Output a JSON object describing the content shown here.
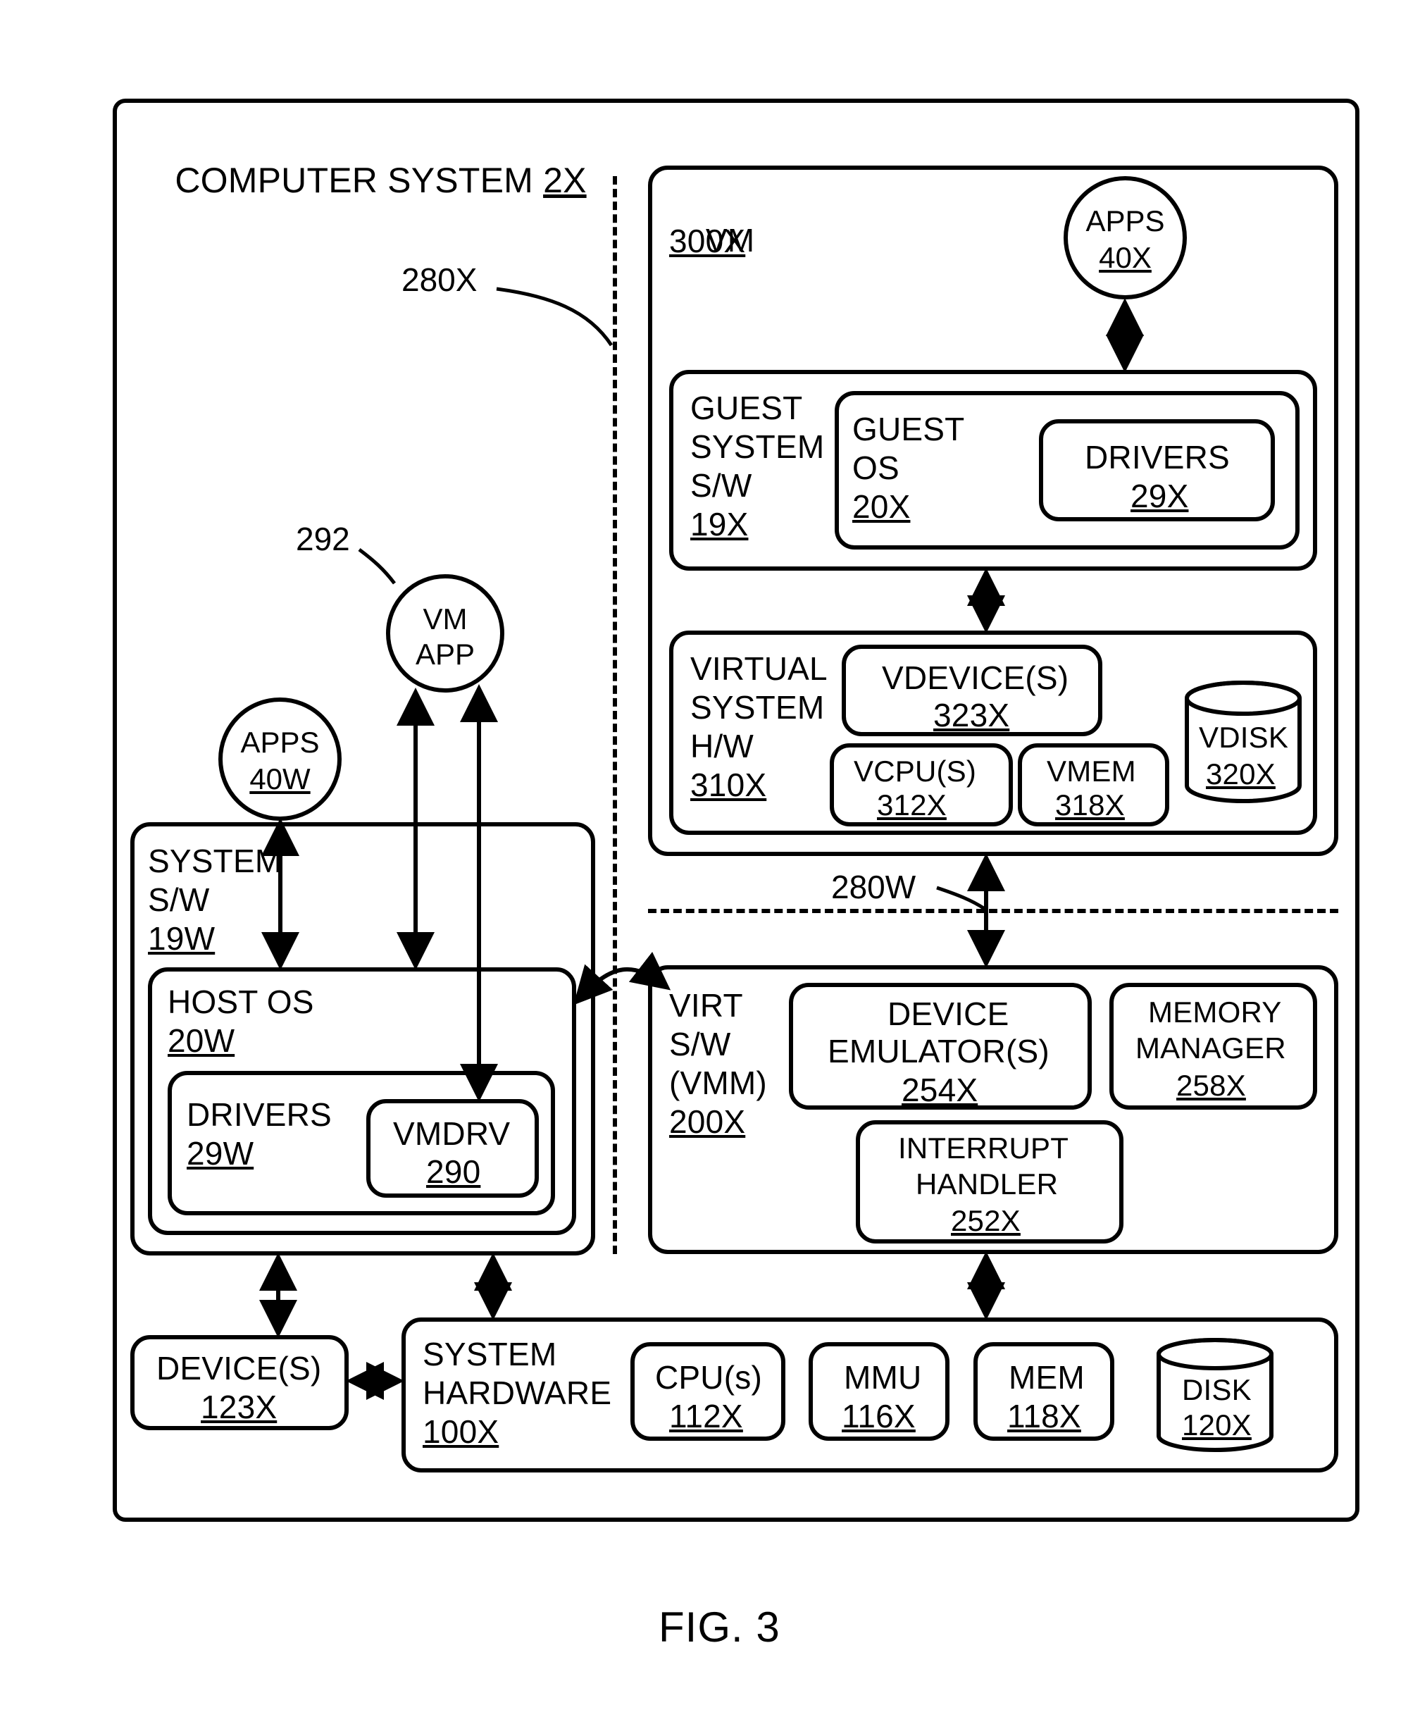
{
  "figure_caption": "FIG. 3",
  "outer": {
    "title": "COMPUTER SYSTEM",
    "ref": "2X"
  },
  "callouts": {
    "c280x": "280X",
    "c292": "292",
    "c280w": "280W"
  },
  "apps40x": {
    "l1": "APPS",
    "ref": "40X"
  },
  "apps40w": {
    "l1": "APPS",
    "ref": "40W"
  },
  "vmapp": {
    "l1": "VM",
    "l2": "APP"
  },
  "vm": {
    "title": "VM",
    "ref": "300X"
  },
  "guest_sw": {
    "l1": "GUEST",
    "l2": "SYSTEM",
    "l3": "S/W",
    "ref": "19X"
  },
  "guest_os": {
    "l1": "GUEST",
    "l2": "OS",
    "ref": "20X"
  },
  "drivers29x": {
    "l1": "DRIVERS",
    "ref": "29X"
  },
  "vhw": {
    "l1": "VIRTUAL",
    "l2": "SYSTEM",
    "l3": "H/W",
    "ref": "310X"
  },
  "vdevices": {
    "l1": "VDEVICE(S)",
    "ref": "323X"
  },
  "vcpus": {
    "l1": "VCPU(S)",
    "ref": "312X"
  },
  "vmem": {
    "l1": "VMEM",
    "ref": "318X"
  },
  "vdisk": {
    "l1": "VDISK",
    "ref": "320X"
  },
  "vmm": {
    "l1": "VIRT",
    "l2": "S/W",
    "l3": "(VMM)",
    "ref": "200X"
  },
  "devemu": {
    "l1": "DEVICE",
    "l2": "EMULATOR(S)",
    "ref": "254X"
  },
  "memmgr": {
    "l1": "MEMORY",
    "l2": "MANAGER",
    "ref": "258X"
  },
  "inth": {
    "l1": "INTERRUPT",
    "l2": "HANDLER",
    "ref": "252X"
  },
  "sys_sw": {
    "l1": "SYSTEM",
    "l2": "S/W",
    "ref": "19W"
  },
  "hostos": {
    "l1": "HOST OS",
    "ref": "20W"
  },
  "drivers29w": {
    "l1": "DRIVERS",
    "ref": "29W"
  },
  "vmdrv": {
    "l1": "VMDRV",
    "ref": "290"
  },
  "devices": {
    "l1": "DEVICE(S)",
    "ref": "123X"
  },
  "syshw": {
    "l1": "SYSTEM",
    "l2": "HARDWARE",
    "ref": "100X"
  },
  "cpus": {
    "l1": "CPU(s)",
    "ref": "112X"
  },
  "mmu": {
    "l1": "MMU",
    "ref": "116X"
  },
  "mem": {
    "l1": "MEM",
    "ref": "118X"
  },
  "disk": {
    "l1": "DISK",
    "ref": "120X"
  }
}
